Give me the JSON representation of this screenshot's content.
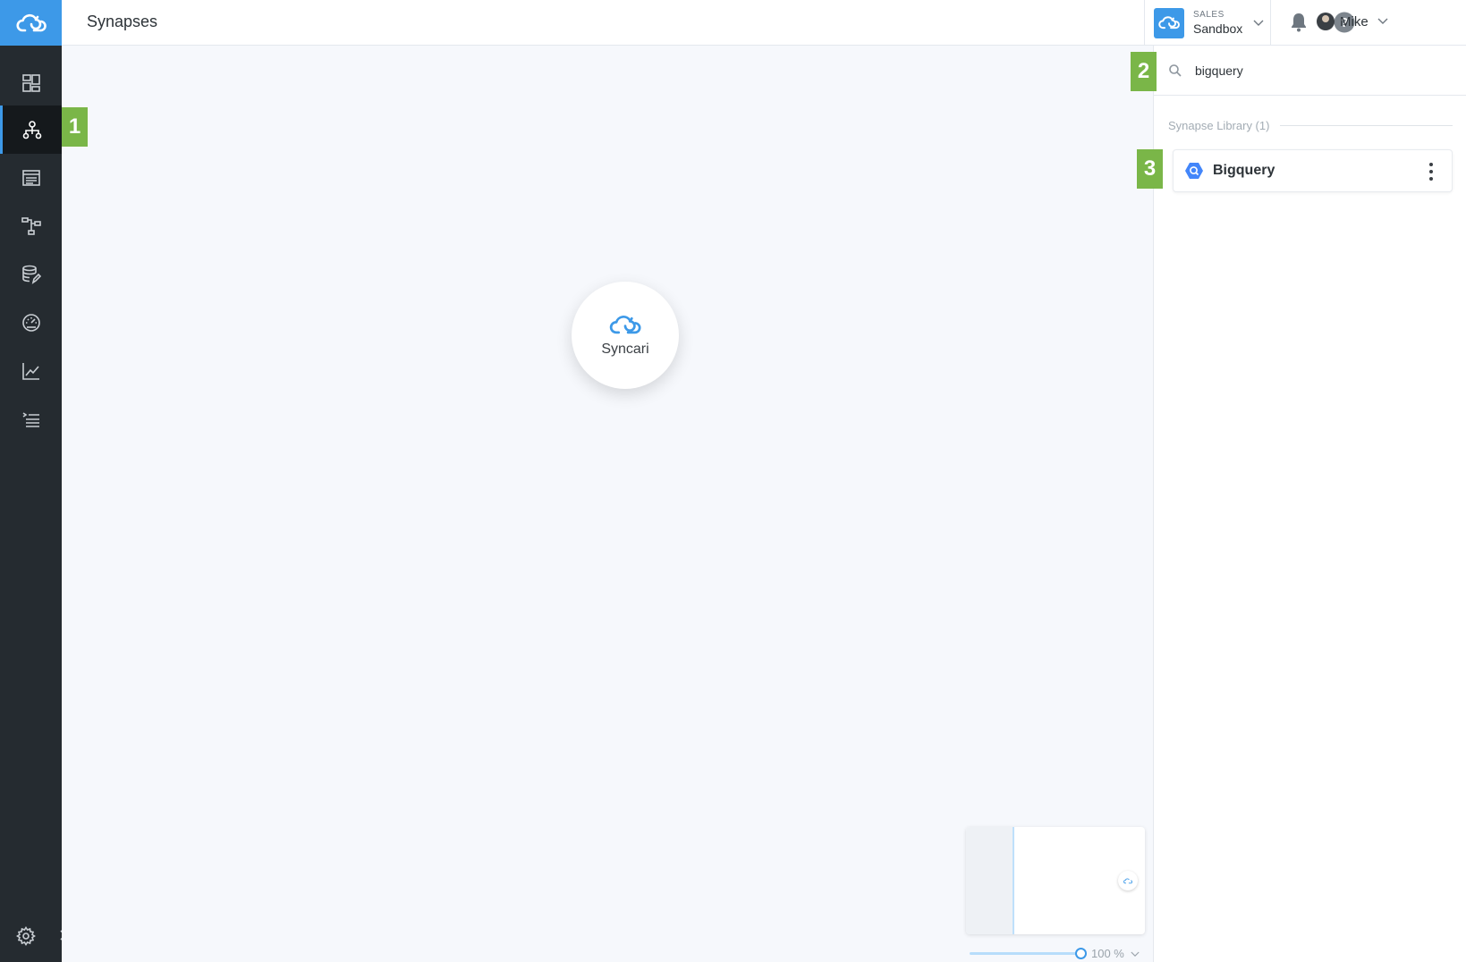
{
  "header": {
    "title": "Synapses",
    "workspace_kicker": "SALES",
    "workspace_name": "Sandbox",
    "user_name": "Mike"
  },
  "nav": {
    "items": [
      "dashboard-icon",
      "synapses-icon",
      "entities-icon",
      "pipeline-icon",
      "data-studio-icon",
      "monitor-icon",
      "analytics-icon",
      "logs-icon"
    ],
    "active": "synapses-icon",
    "accent": "#3d99e8",
    "background": "#252b30"
  },
  "canvas": {
    "node_label": "Syncari",
    "zoom_label": "100 %"
  },
  "panel": {
    "search_value": "bigquery",
    "library_title": "Synapse Library (1)",
    "cards": [
      {
        "title": "Bigquery",
        "icon": "bigquery-icon"
      }
    ]
  },
  "badges": [
    "1",
    "2",
    "3"
  ],
  "badge_color": "#7ab648"
}
